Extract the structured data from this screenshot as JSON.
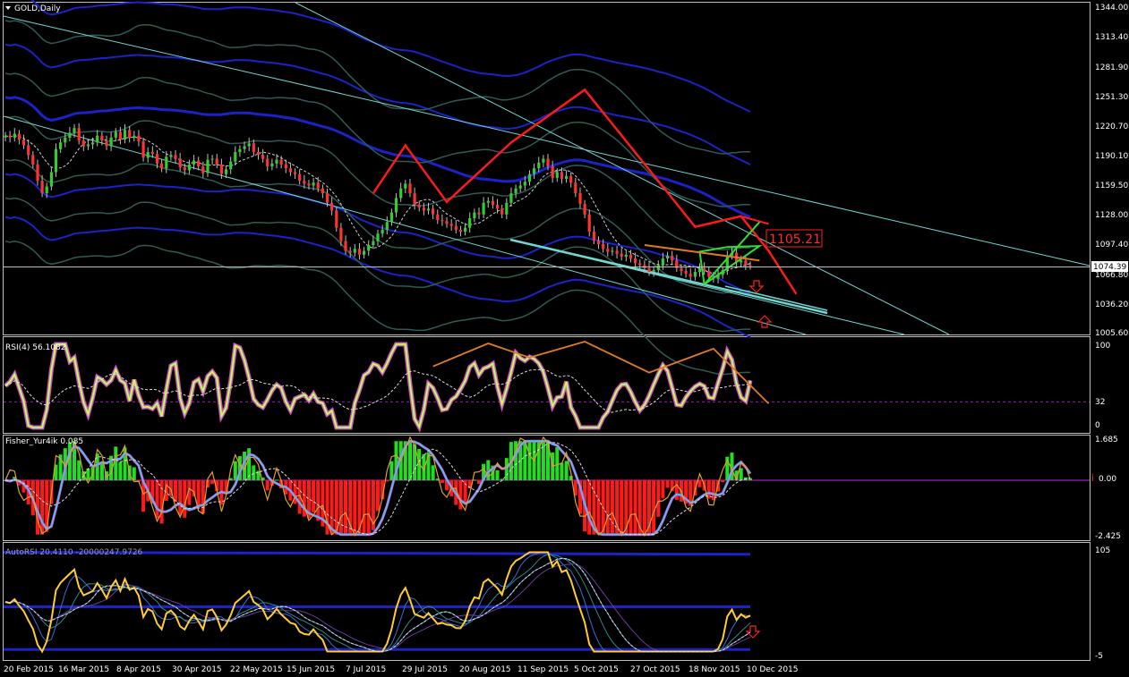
{
  "window": {
    "symbol_title": "GOLD,Daily"
  },
  "colors": {
    "background": "#000000",
    "frame": "#c0c0c0",
    "bull_candle": "#33cc33",
    "bear_candle": "#ff3333",
    "channel_blue": "#1a22c8",
    "channel_teal": "#2f5a56",
    "trendline_cyan": "#6fd6d0",
    "zigzag_red": "#ff1a1a",
    "rsi_orange": "#e07a26",
    "fisher_green": "#22dd22",
    "fisher_red": "#ff1a1a",
    "price_line": "#c0c0c0"
  },
  "main_panel": {
    "price_axis": [
      "1344.00",
      "1313.40",
      "1281.90",
      "1251.30",
      "1220.70",
      "1190.10",
      "1159.50",
      "1128.00",
      "1097.40",
      "1066.80",
      "1036.20",
      "1005.60"
    ],
    "current_price": "1074.39",
    "annotation_price": "1105.21",
    "y_min": 1005.6,
    "y_max": 1344.0
  },
  "rsi_panel": {
    "label": "RSI(4) 56.1082",
    "axis": [
      "100",
      "32",
      "0"
    ]
  },
  "fisher_panel": {
    "label": "Fisher_Yur4ik 0.085",
    "axis": [
      "1.685",
      "0.00",
      "-2.425"
    ]
  },
  "bottom_panel": {
    "label": "AutoRSI 20.4110 -20000247.9726",
    "axis": [
      "105",
      "-5"
    ]
  },
  "time_axis": [
    "20 Feb 2015",
    "16 Mar 2015",
    "8 Apr 2015",
    "30 Apr 2015",
    "22 May 2015",
    "15 Jun 2015",
    "7 Jul 2015",
    "29 Jul 2015",
    "20 Aug 2015",
    "11 Sep 2015",
    "5 Oct 2015",
    "27 Oct 2015",
    "18 Nov 2015",
    "10 Dec 2015"
  ],
  "chart_data": {
    "type": "candlestick",
    "title": "GOLD,Daily",
    "dates": [
      "20 Feb 2015",
      "16 Mar 2015",
      "8 Apr 2015",
      "30 Apr 2015",
      "22 May 2015",
      "15 Jun 2015",
      "7 Jul 2015",
      "29 Jul 2015",
      "20 Aug 2015",
      "11 Sep 2015",
      "5 Oct 2015",
      "27 Oct 2015",
      "18 Nov 2015",
      "10 Dec 2015"
    ],
    "close_series": [
      1210,
      1208,
      1212,
      1206,
      1200,
      1190,
      1180,
      1163,
      1150,
      1157,
      1172,
      1196,
      1203,
      1208,
      1213,
      1218,
      1205,
      1199,
      1201,
      1203,
      1210,
      1205,
      1199,
      1208,
      1214,
      1206,
      1216,
      1208,
      1210,
      1204,
      1187,
      1193,
      1191,
      1181,
      1176,
      1188,
      1190,
      1186,
      1177,
      1174,
      1180,
      1184,
      1178,
      1171,
      1185,
      1186,
      1180,
      1170,
      1175,
      1183,
      1193,
      1196,
      1199,
      1202,
      1193,
      1190,
      1186,
      1178,
      1181,
      1185,
      1180,
      1176,
      1172,
      1170,
      1163,
      1160,
      1158,
      1161,
      1155,
      1150,
      1140,
      1132,
      1114,
      1100,
      1090,
      1088,
      1092,
      1086,
      1090,
      1096,
      1100,
      1108,
      1112,
      1120,
      1130,
      1145,
      1155,
      1160,
      1150,
      1138,
      1135,
      1132,
      1134,
      1128,
      1122,
      1121,
      1118,
      1116,
      1112,
      1110,
      1114,
      1124,
      1130,
      1128,
      1140,
      1142,
      1138,
      1134,
      1128,
      1140,
      1150,
      1155,
      1158,
      1162,
      1170,
      1176,
      1182,
      1186,
      1178,
      1166,
      1172,
      1165,
      1168,
      1161,
      1150,
      1139,
      1128,
      1110,
      1101,
      1097,
      1092,
      1089,
      1090,
      1087,
      1084,
      1086,
      1082,
      1077,
      1075,
      1072,
      1068,
      1070,
      1075,
      1082,
      1085,
      1080,
      1072,
      1069,
      1066,
      1063,
      1068,
      1072,
      1069,
      1063,
      1061,
      1065,
      1070,
      1085,
      1088,
      1078,
      1080,
      1075,
      1074.39
    ],
    "current_price": 1074.39,
    "annotations": [
      "1105.21"
    ],
    "ylim": [
      1005.6,
      1344.0
    ],
    "indicators": [
      "RSI(4) 56.1082",
      "Fisher_Yur4ik 0.085",
      "AutoRSI 20.4110 -20000247.9726"
    ]
  }
}
